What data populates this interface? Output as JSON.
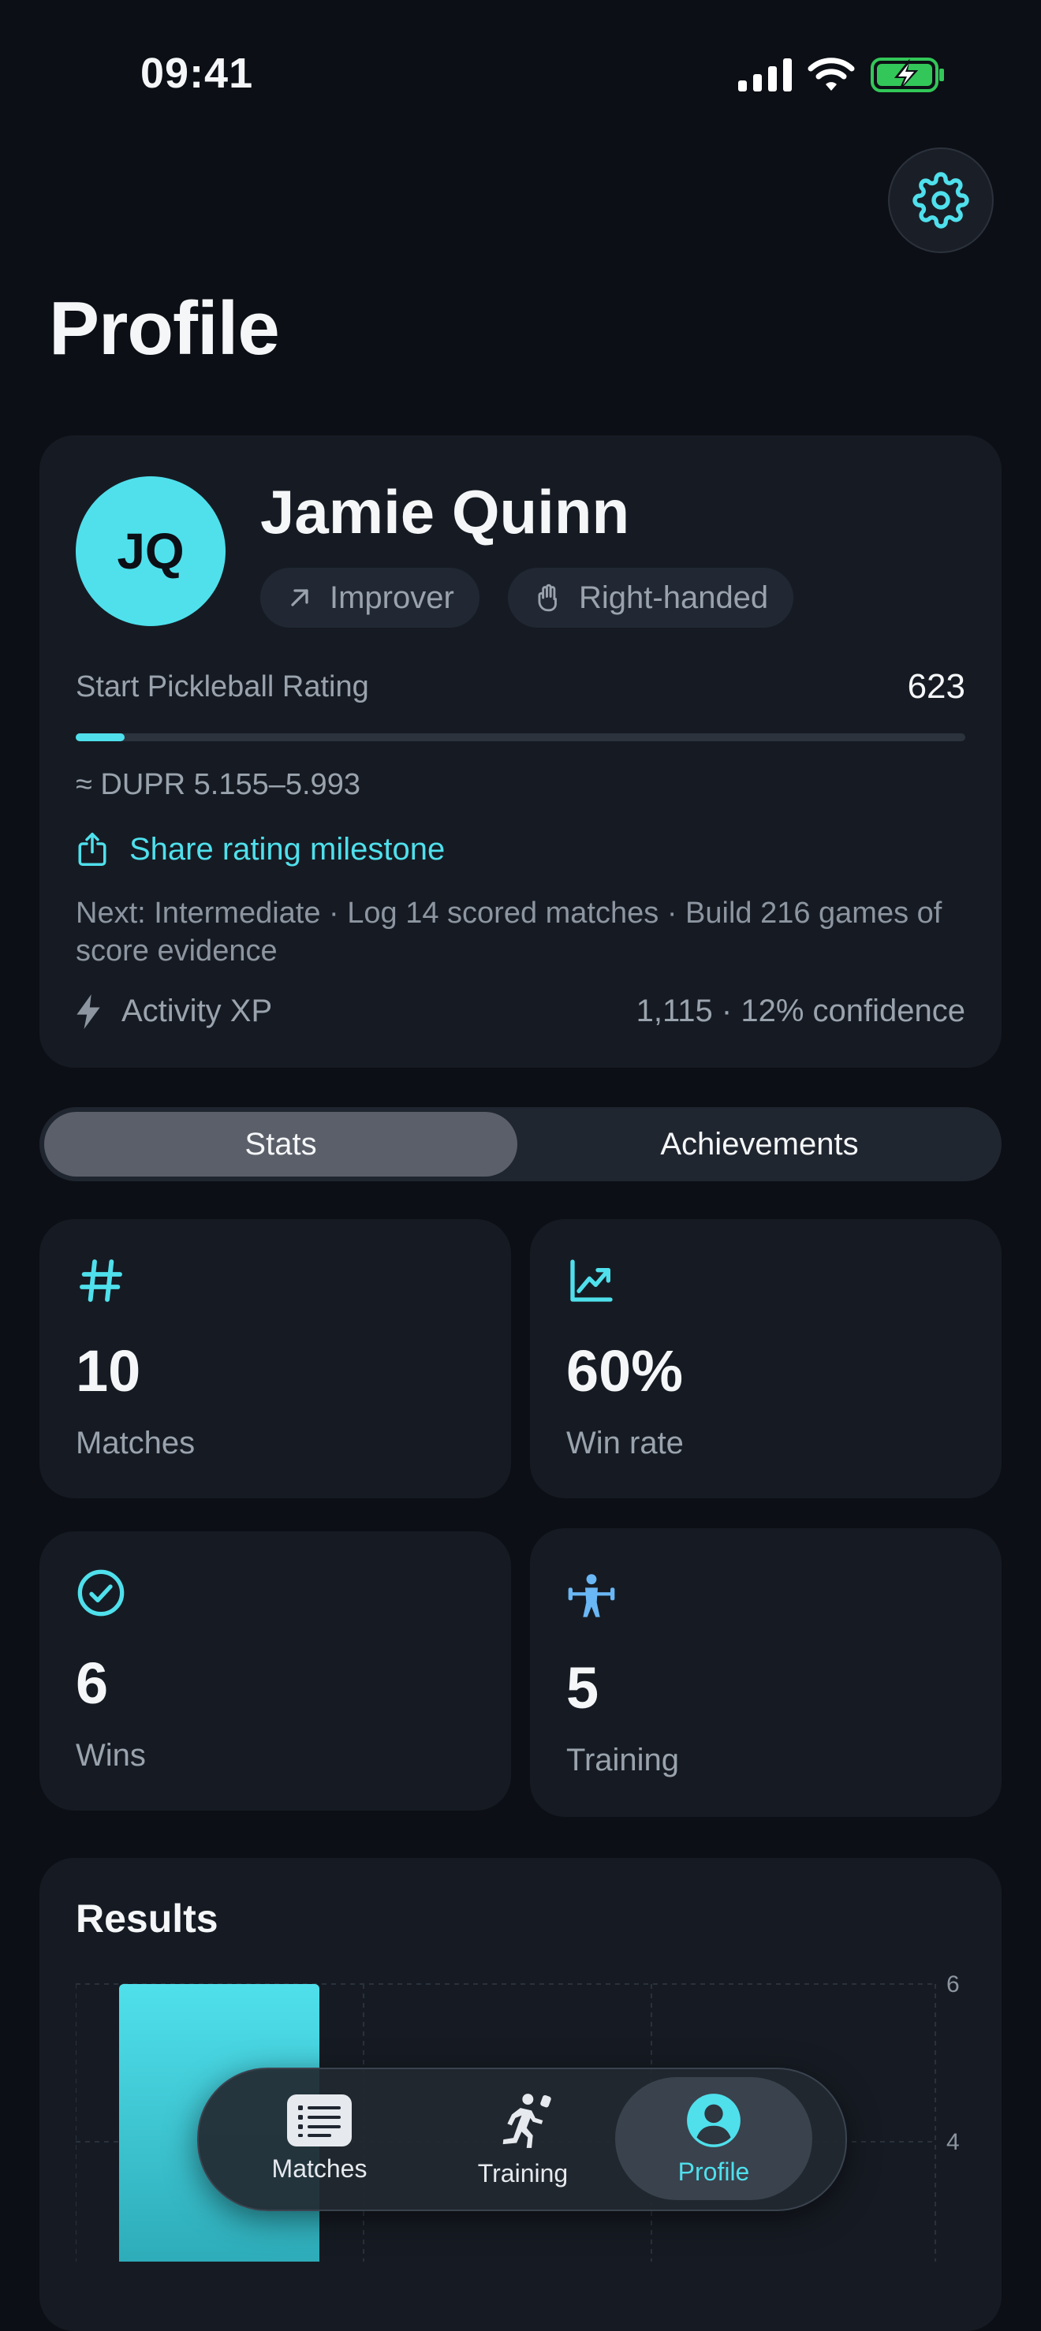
{
  "status_bar": {
    "time": "09:41"
  },
  "page": {
    "title": "Profile"
  },
  "profile": {
    "initials": "JQ",
    "name": "Jamie Quinn",
    "chips": [
      "Improver",
      "Right-handed"
    ],
    "rating_label": "Start Pickleball Rating",
    "rating_value": "623",
    "rating_progress_fraction": 0.055,
    "dupr_range": "≈ DUPR 5.155–5.993",
    "share_label": "Share rating milestone",
    "next_text": "Next: Intermediate · Log 14 scored matches · Build 216 games of score evidence",
    "xp_label": "Activity XP",
    "xp_value": "1,115 · 12% confidence"
  },
  "segments": {
    "stats": "Stats",
    "achievements": "Achievements",
    "active": "Stats"
  },
  "stats": [
    {
      "value": "10",
      "label": "Matches",
      "icon": "hash-icon"
    },
    {
      "value": "60%",
      "label": "Win rate",
      "icon": "trend-up-chart-icon"
    },
    {
      "value": "6",
      "label": "Wins",
      "icon": "check-circle-icon"
    },
    {
      "value": "5",
      "label": "Training",
      "icon": "weightlifter-icon"
    }
  ],
  "results": {
    "title": "Results"
  },
  "chart_data": {
    "type": "bar",
    "y_ticks": [
      6,
      4
    ],
    "ylim": [
      0,
      6
    ],
    "bars": [
      {
        "value": 6,
        "color": "#4fe0ec"
      },
      {
        "value": 0.5,
        "color": "#3a2224"
      }
    ],
    "grid": true
  },
  "tabbar": {
    "tabs": [
      "Matches",
      "Training",
      "Profile"
    ],
    "active": "Profile",
    "accent": "#4fe0ec"
  },
  "colors": {
    "accent": "#4fe0ec",
    "background": "#0c0f15",
    "card": "#161b23",
    "battery": "#33c759"
  }
}
